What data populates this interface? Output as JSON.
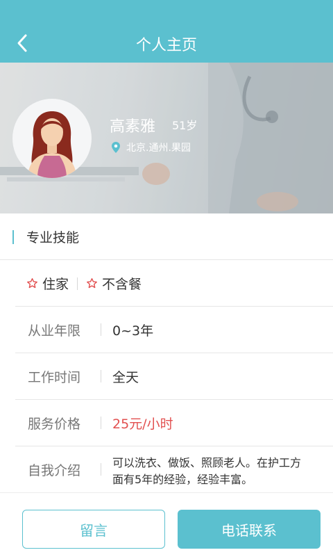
{
  "header": {
    "title": "个人主页",
    "back_icon": "chevron-left-icon"
  },
  "profile": {
    "name": "高素雅",
    "age": "51岁",
    "location": "北京.通州.果园",
    "location_icon": "map-pin-icon"
  },
  "section": {
    "title": "专业技能"
  },
  "tags": [
    {
      "label": "住家",
      "icon": "star-outline-icon"
    },
    {
      "label": "不含餐",
      "icon": "star-outline-icon"
    }
  ],
  "details": {
    "experience": {
      "label": "从业年限",
      "value": "0~3年"
    },
    "work_time": {
      "label": "工作时间",
      "value": "全天"
    },
    "price": {
      "label": "服务价格",
      "value": "25元/小时"
    },
    "intro": {
      "label": "自我介绍",
      "value": "可以洗衣、做饭、照顾老人。在护工方面有5年的经验，经验丰富。"
    }
  },
  "footer": {
    "message_label": "留言",
    "call_label": "电话联系"
  },
  "colors": {
    "accent": "#5bc0cf",
    "price": "#e25050",
    "star": "#e25050"
  }
}
